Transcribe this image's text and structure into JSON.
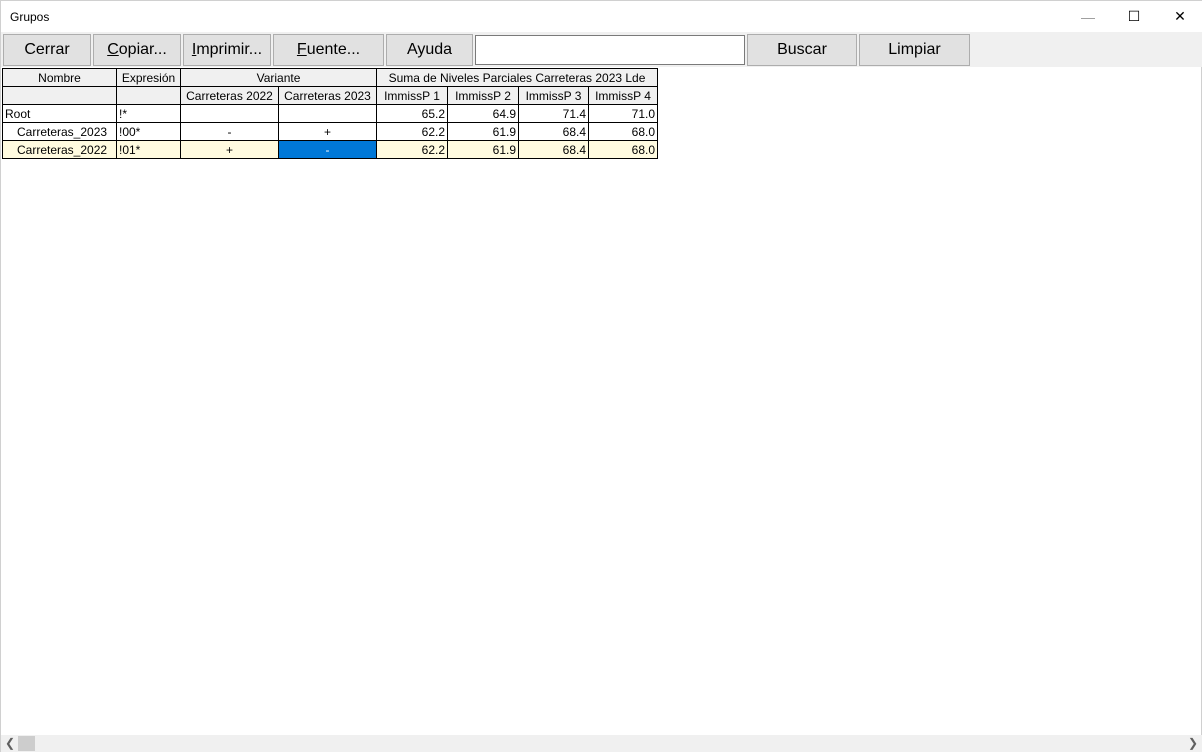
{
  "window": {
    "title": "Grupos",
    "minimize": "—",
    "maximize": "☐",
    "close": "✕"
  },
  "toolbar": {
    "close_label": "Cerrar",
    "copy_u": "C",
    "copy_rest": "opiar...",
    "print_u": "I",
    "print_rest": "mprimir...",
    "font_u": "F",
    "font_rest": "uente...",
    "help_label": "Ayuda",
    "search_value": "",
    "search_label": "Buscar",
    "clear_label": "Limpiar"
  },
  "table": {
    "headers": {
      "name": "Nombre",
      "expr": "Expresión",
      "variant": "Variante",
      "sum": "Suma de Niveles Parciales Carreteras 2023 Lde"
    },
    "subheaders": [
      "Carreteras 2022",
      "Carreteras 2023",
      "ImmissP 1",
      "ImmissP 2",
      "ImmissP 3",
      "ImmissP 4"
    ],
    "rows": [
      {
        "name": "Root",
        "expr": "!*",
        "v2022": "",
        "v2023": "",
        "p1": "65.2",
        "p2": "64.9",
        "p3": "71.4",
        "p4": "71.0"
      },
      {
        "name": "Carreteras_2023",
        "expr": "!00*",
        "v2022": "-",
        "v2023": "+",
        "p1": "62.2",
        "p2": "61.9",
        "p3": "68.4",
        "p4": "68.0"
      },
      {
        "name": "Carreteras_2022",
        "expr": "!01*",
        "v2022": "+",
        "v2023": "-",
        "p1": "62.2",
        "p2": "61.9",
        "p3": "68.4",
        "p4": "68.0"
      }
    ]
  },
  "scrollbar": {
    "left": "❮",
    "right": "❯"
  }
}
